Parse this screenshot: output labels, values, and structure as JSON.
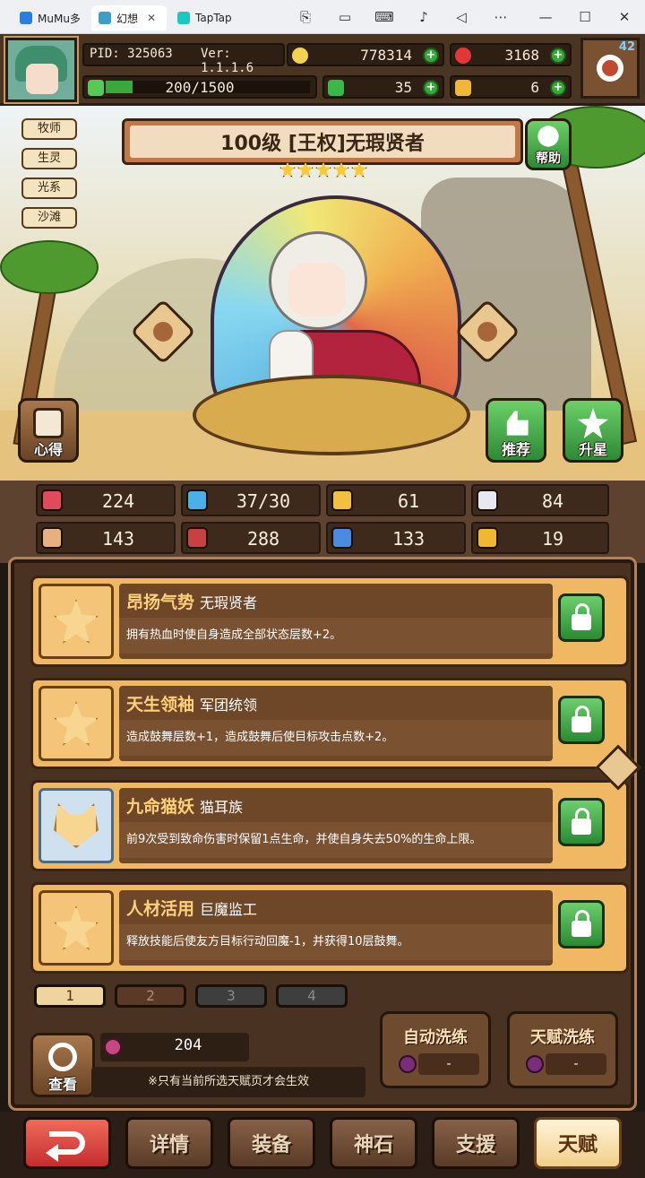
{
  "browser": {
    "tabs": [
      {
        "label": "MuMu多",
        "color": "#2a7de1"
      },
      {
        "label": "幻想",
        "color": "#3aa0c8"
      },
      {
        "label": "TapTap",
        "color": "#1ec8c0"
      }
    ]
  },
  "player": {
    "pid": "PID: 325063",
    "version": "Ver: 1.1.1.6",
    "exp": "200/1500",
    "exp_progress": 0.133,
    "settings_badge": "42"
  },
  "resources": {
    "gold": "778314",
    "ruby": "3168",
    "clover": "35",
    "ticket": "6"
  },
  "hero": {
    "title": "100级 [王权]无瑕贤者",
    "stars": 5,
    "tags": [
      "牧师",
      "生灵",
      "光系",
      "沙滩"
    ],
    "help_label": "帮助",
    "notes_label": "心得",
    "recommend_label": "推荐",
    "starup_label": "升星"
  },
  "stats": [
    {
      "icon": "heart-icon",
      "value": "224",
      "color": "#e04a5a"
    },
    {
      "icon": "water-drop-icon",
      "value": "37/30",
      "color": "#4ab0e8"
    },
    {
      "icon": "shield-icon",
      "value": "61",
      "color": "#f0c040"
    },
    {
      "icon": "wing-icon",
      "value": "84",
      "color": "#e8e8f0"
    },
    {
      "icon": "fist-icon",
      "value": "143",
      "color": "#e8b080"
    },
    {
      "icon": "book-icon",
      "value": "288",
      "color": "#c84040"
    },
    {
      "icon": "boot-icon",
      "value": "133",
      "color": "#4a8ae0"
    },
    {
      "icon": "horseshoe-icon",
      "value": "19",
      "color": "#f0b830"
    }
  ],
  "talents": [
    {
      "name": "昂扬气势",
      "source": "无瑕贤者",
      "desc": "拥有热血时使自身造成全部状态层数+2。",
      "icon": "star-icon"
    },
    {
      "name": "天生领袖",
      "source": "军团统领",
      "desc": "造成鼓舞层数+1，造成鼓舞后使目标攻击点数+2。",
      "icon": "star-icon"
    },
    {
      "name": "九命猫妖",
      "source": "猫耳族",
      "desc": "前9次受到致命伤害时保留1点生命，并使自身失去50%的生命上限。",
      "icon": "cat-icon"
    },
    {
      "name": "人材活用",
      "source": "巨魔监工",
      "desc": "释放技能后使友方目标行动回魔-1，并获得10层鼓舞。",
      "icon": "star-icon"
    }
  ],
  "pages": [
    "1",
    "2",
    "3",
    "4"
  ],
  "berries": "204",
  "view_label": "查看",
  "notice": "※只有当前所选天赋页才会生效",
  "auto_refine": {
    "label": "自动洗练",
    "value": "-"
  },
  "talent_refine": {
    "label": "天赋洗练",
    "value": "-"
  },
  "nav": [
    "详情",
    "装备",
    "神石",
    "支援",
    "天赋"
  ]
}
